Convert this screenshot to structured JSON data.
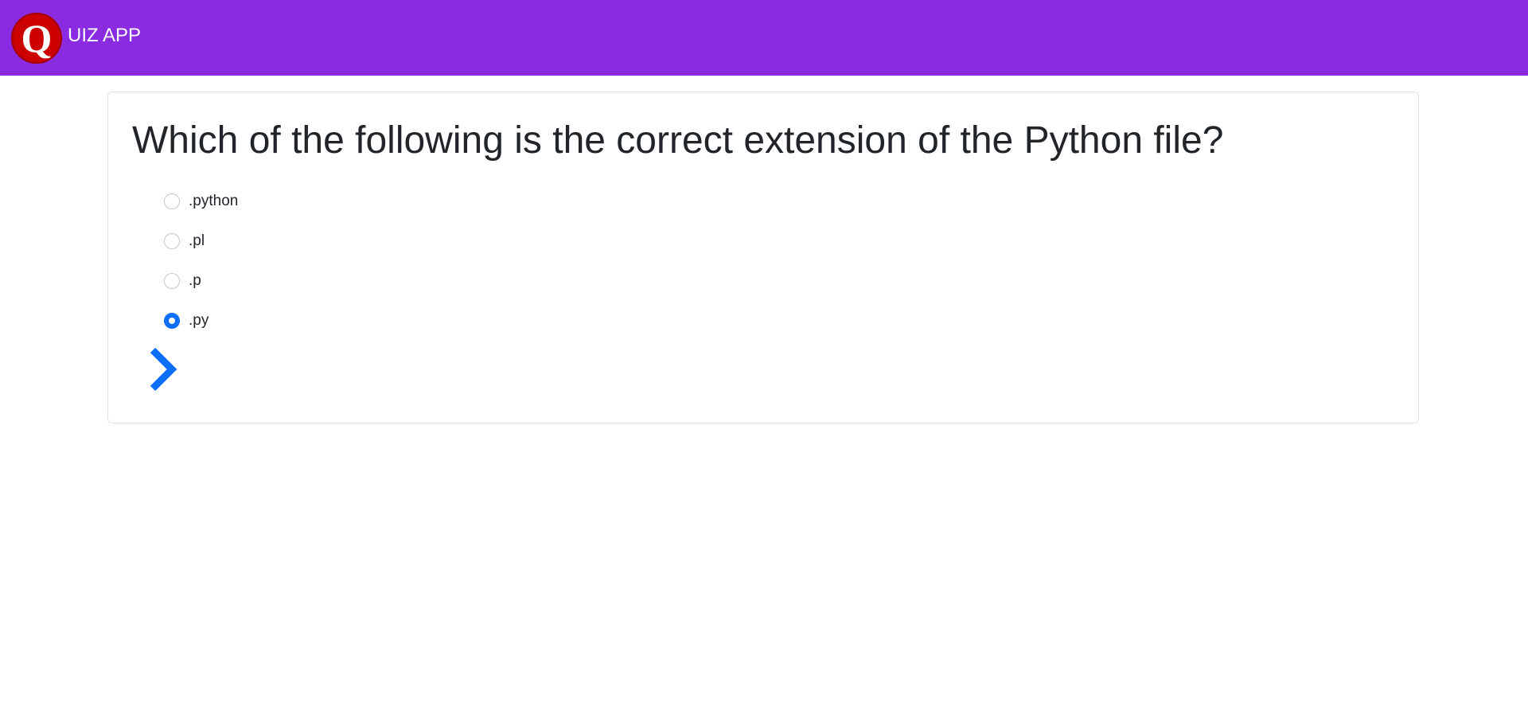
{
  "header": {
    "logo_letter": "Q",
    "title": "UIZ APP",
    "background_color": "#8a2be2",
    "logo_color": "#cc0000"
  },
  "quiz": {
    "question": "Which of the following is the correct extension of the Python file?",
    "options": [
      {
        "label": ".python",
        "selected": false
      },
      {
        "label": ".pl",
        "selected": false
      },
      {
        "label": ".p",
        "selected": false
      },
      {
        "label": ".py",
        "selected": true
      }
    ],
    "next_icon": "chevron-right-icon",
    "accent_color": "#0d6efd"
  }
}
